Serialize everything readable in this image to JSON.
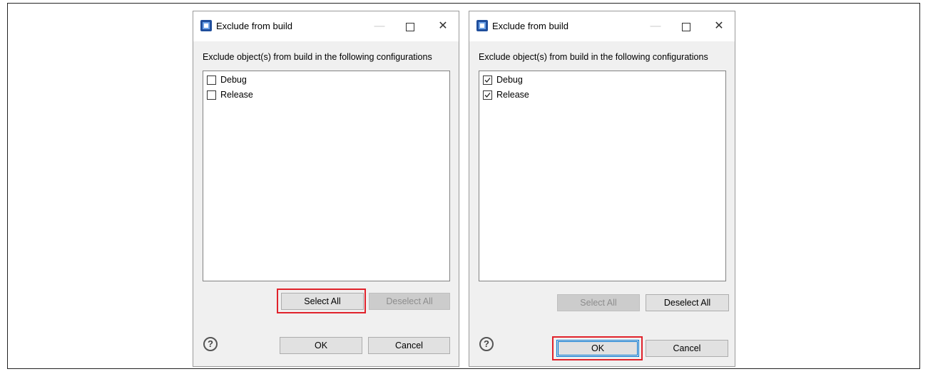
{
  "dialogs": [
    {
      "title": "Exclude from build",
      "instruction": "Exclude object(s) from build in the following configurations",
      "items": [
        {
          "label": "Debug",
          "checked": false
        },
        {
          "label": "Release",
          "checked": false
        }
      ],
      "select_all_label": "Select All",
      "select_all_enabled": true,
      "deselect_all_label": "Deselect All",
      "deselect_all_enabled": false,
      "ok_label": "OK",
      "cancel_label": "Cancel",
      "help_glyph": "?",
      "highlighted": "select-all-button"
    },
    {
      "title": "Exclude from build",
      "instruction": "Exclude object(s) from build in the following configurations",
      "items": [
        {
          "label": "Debug",
          "checked": true
        },
        {
          "label": "Release",
          "checked": true
        }
      ],
      "select_all_label": "Select All",
      "select_all_enabled": false,
      "deselect_all_label": "Deselect All",
      "deselect_all_enabled": true,
      "ok_label": "OK",
      "cancel_label": "Cancel",
      "help_glyph": "?",
      "highlighted": "ok-button"
    }
  ],
  "colors": {
    "highlight": "#e0222b",
    "focus": "#0078d7",
    "app_icon": "#1f4e9c"
  },
  "icons": {
    "app": "eclipse-app-icon",
    "help": "help-icon",
    "minimize": "minimize-icon",
    "maximize": "maximize-icon",
    "close": "close-icon",
    "check": "checkmark-icon"
  }
}
